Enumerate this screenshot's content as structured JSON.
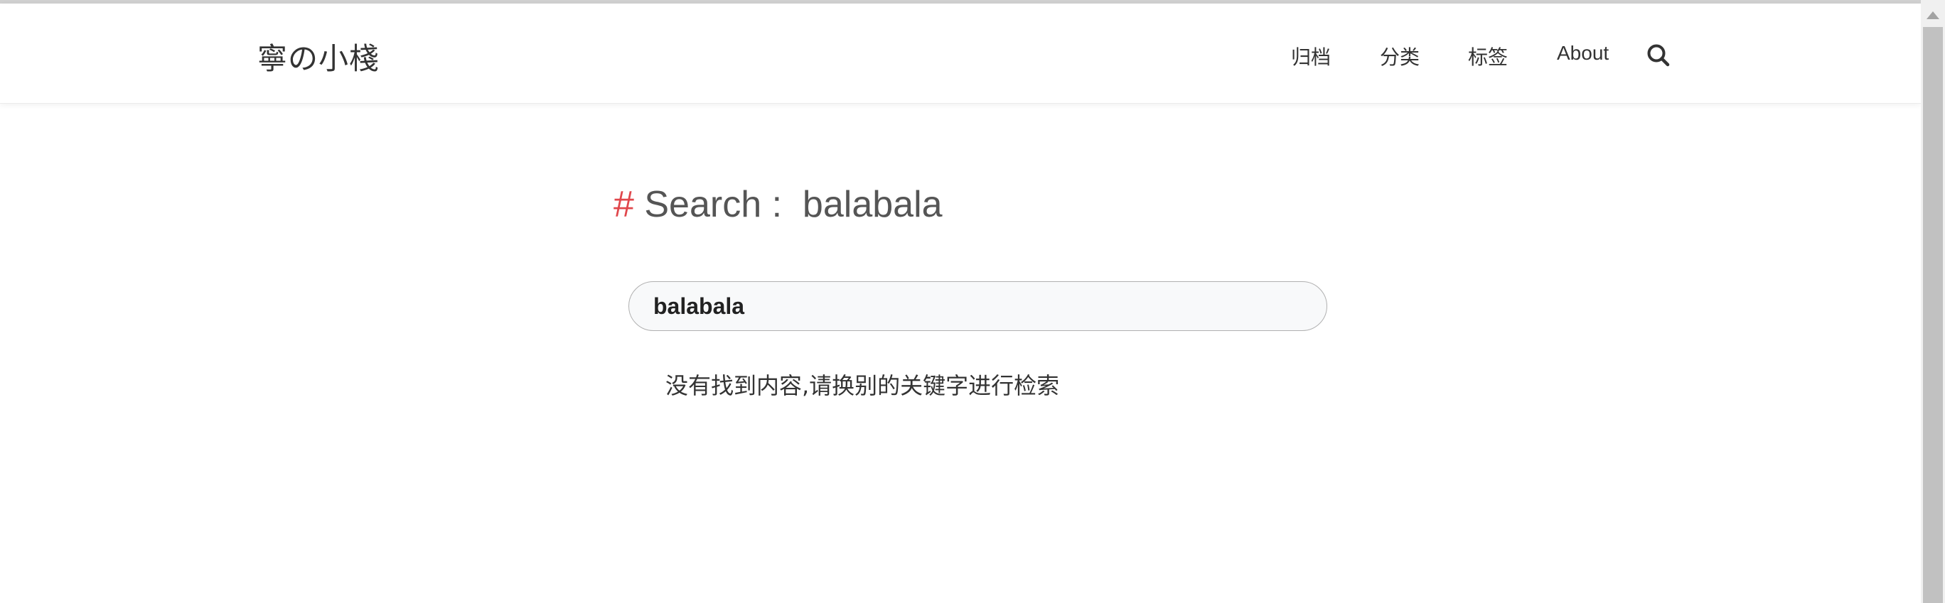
{
  "header": {
    "site_title": "寧の小棧",
    "nav": {
      "archive": "归档",
      "categories": "分类",
      "tags": "标签",
      "about": "About"
    },
    "search_icon": "search-icon"
  },
  "main": {
    "heading_hash": "#",
    "heading_text": "Search :  balabala",
    "search_value": "balabala",
    "no_result_text": "没有找到内容,请换别的关键字进行检索"
  },
  "colors": {
    "accent": "#e0474c",
    "heading": "#555555",
    "text": "#333333"
  }
}
